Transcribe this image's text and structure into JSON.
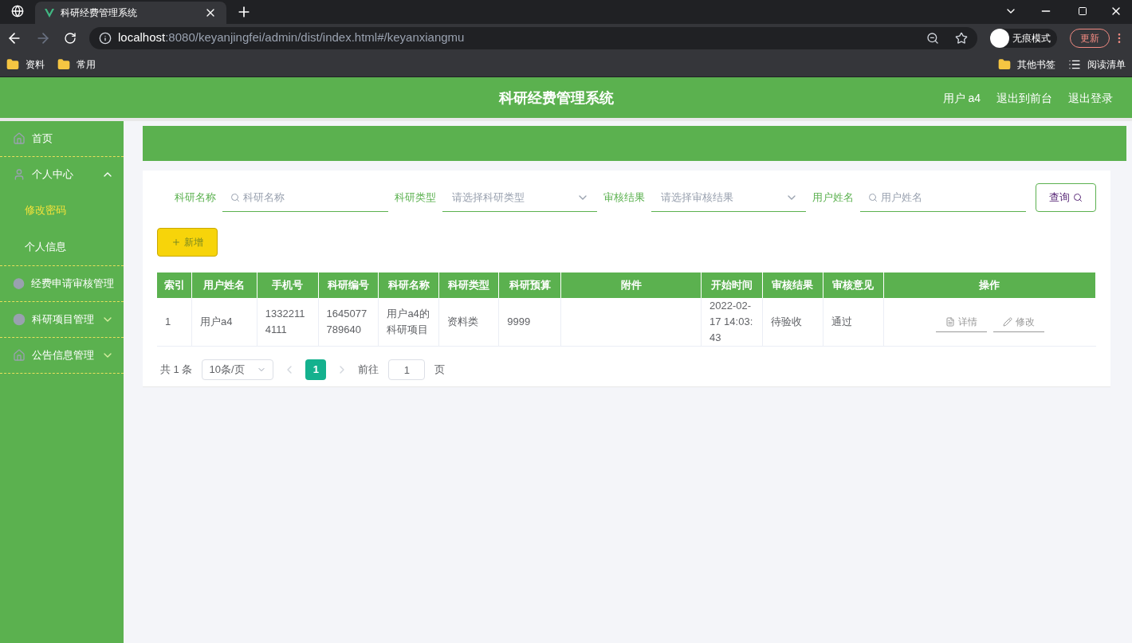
{
  "browser": {
    "tab_title": "科研经费管理系统",
    "url_host": "localhost",
    "url_rest": ":8080/keyanjingfei/admin/dist/index.html#/keyanxiangmu",
    "incognito": "无痕模式",
    "update": "更新",
    "bookmarks": [
      "资料",
      "常用"
    ],
    "other_bookmarks": "其他书签",
    "reading_list": "阅读清单"
  },
  "header": {
    "title": "科研经费管理系统",
    "links": [
      "用户 a4",
      "退出到前台",
      "退出登录"
    ]
  },
  "sidebar": {
    "items": [
      {
        "label": "首页"
      },
      {
        "label": "个人中心",
        "expanded": true,
        "children": [
          {
            "label": "修改密码",
            "selected": true
          },
          {
            "label": "个人信息",
            "selected": false
          }
        ]
      },
      {
        "label": "经费申请审核管理"
      },
      {
        "label": "科研项目管理",
        "expanded": false
      },
      {
        "label": "公告信息管理",
        "expanded": false
      }
    ]
  },
  "filters": [
    {
      "kind": "search",
      "label": "科研名称",
      "placeholder": "科研名称"
    },
    {
      "kind": "select",
      "label": "科研类型",
      "placeholder": "请选择科研类型"
    },
    {
      "kind": "select",
      "label": "审核结果",
      "placeholder": "请选择审核结果"
    },
    {
      "kind": "search",
      "label": "用户姓名",
      "placeholder": "用户姓名"
    }
  ],
  "query_button": "查询",
  "add_button": "新增",
  "table": {
    "columns": [
      "索引",
      "用户姓名",
      "手机号",
      "科研编号",
      "科研名称",
      "科研类型",
      "科研预算",
      "附件",
      "开始时间",
      "审核结果",
      "审核意见",
      "操作"
    ],
    "rows": [
      {
        "cells": [
          "1",
          "用户a4",
          "13322114111",
          "1645077789640",
          "用户a4的科研项目",
          "资料类",
          "9999",
          "",
          "2022-02-17 14:03:43",
          "待验收",
          "通过"
        ],
        "actions": [
          "详情",
          "修改"
        ]
      }
    ]
  },
  "pagination": {
    "total": "共 1 条",
    "page_size": "10条/页",
    "pages": [
      {
        "label": "1",
        "selected": true
      }
    ],
    "goto": "前往",
    "goto_value": "1",
    "page_suffix": "页"
  }
}
